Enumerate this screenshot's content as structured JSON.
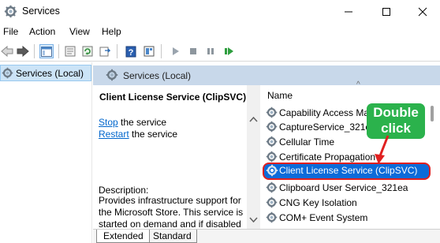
{
  "window": {
    "title": "Services",
    "app_icon": "services-gear-icon"
  },
  "menu": {
    "items": [
      "File",
      "Action",
      "View",
      "Help"
    ]
  },
  "toolbar": {
    "icons": [
      "back-arrow-icon",
      "forward-arrow-icon",
      "show-hide-console-tree-icon",
      "properties-icon",
      "refresh-icon",
      "export-list-icon",
      "help-icon",
      "mmc-snapin-icon",
      "start-service-icon",
      "stop-service-icon",
      "pause-service-icon",
      "restart-service-icon"
    ]
  },
  "tree": {
    "root_label": "Services (Local)"
  },
  "main": {
    "header_label": "Services (Local)"
  },
  "description_panel": {
    "service_title": "Client License Service (ClipSVC)",
    "stop_link": "Stop",
    "stop_suffix": " the service",
    "restart_link": "Restart",
    "restart_suffix": " the service",
    "description_label": "Description:",
    "description_text": "Provides infrastructure support for the Microsoft Store. This service is started on demand and if disabled applications bought using Windows Store will not behave"
  },
  "list": {
    "column_name": "Name",
    "rows": [
      {
        "name": "Capability Access Ma"
      },
      {
        "name": "CaptureService_321ea"
      },
      {
        "name": "Cellular Time"
      },
      {
        "name": "Certificate Propagation"
      },
      {
        "name": "Client License Service (ClipSVC)",
        "selected": true
      },
      {
        "name": "Clipboard User Service_321ea"
      },
      {
        "name": "CNG Key Isolation"
      },
      {
        "name": "COM+ Event System"
      }
    ]
  },
  "annotation": {
    "line1": "Double",
    "line2": "click",
    "color": "#2bb24c",
    "arrow_color": "#e02020"
  },
  "tabs": {
    "extended": "Extended",
    "standard": "Standard"
  },
  "colors": {
    "selection": "#0c6bd9",
    "header_band": "#c8d8ea",
    "tree_selection": "#cce4f7",
    "link": "#0066cc"
  }
}
